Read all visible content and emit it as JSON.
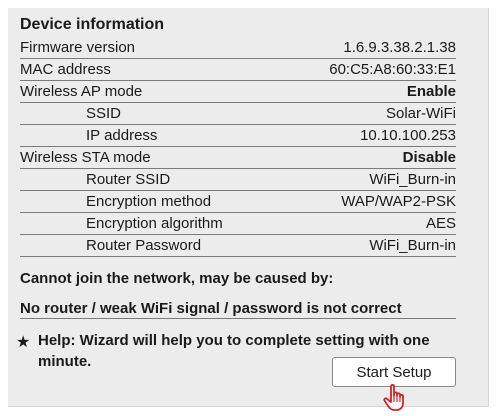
{
  "device_info": {
    "title": "Device information",
    "rows": [
      {
        "label": "Firmware version",
        "value": "1.6.9.3.38.2.1.38"
      },
      {
        "label": "MAC address",
        "value": "60:C5:A8:60:33:E1"
      },
      {
        "label": "Wireless AP mode",
        "value": "Enable"
      },
      {
        "label": "SSID",
        "value": "Solar-WiFi"
      },
      {
        "label": "IP address",
        "value": "10.10.100.253"
      },
      {
        "label": "Wireless STA mode",
        "value": "Disable"
      },
      {
        "label": "Router SSID",
        "value": "WiFi_Burn-in"
      },
      {
        "label": "Encryption method",
        "value": "WAP/WAP2-PSK"
      },
      {
        "label": "Encryption algorithm",
        "value": "AES"
      },
      {
        "label": "Router Password",
        "value": "WiFi_Burn-in"
      }
    ]
  },
  "notice": {
    "cause_heading": "Cannot join the network, may be caused by:",
    "cause_detail": "No router / weak WiFi signal / password is not correct",
    "help_symbol": "★",
    "help_text": "Help: Wizard will help you to complete setting with one minute."
  },
  "actions": {
    "start_setup_label": "Start Setup"
  },
  "icons": {
    "help": "star-icon",
    "pointer": "hand-cursor-icon"
  },
  "colors": {
    "panel_background": "#ececec",
    "cursor_red": "#d9201f"
  }
}
